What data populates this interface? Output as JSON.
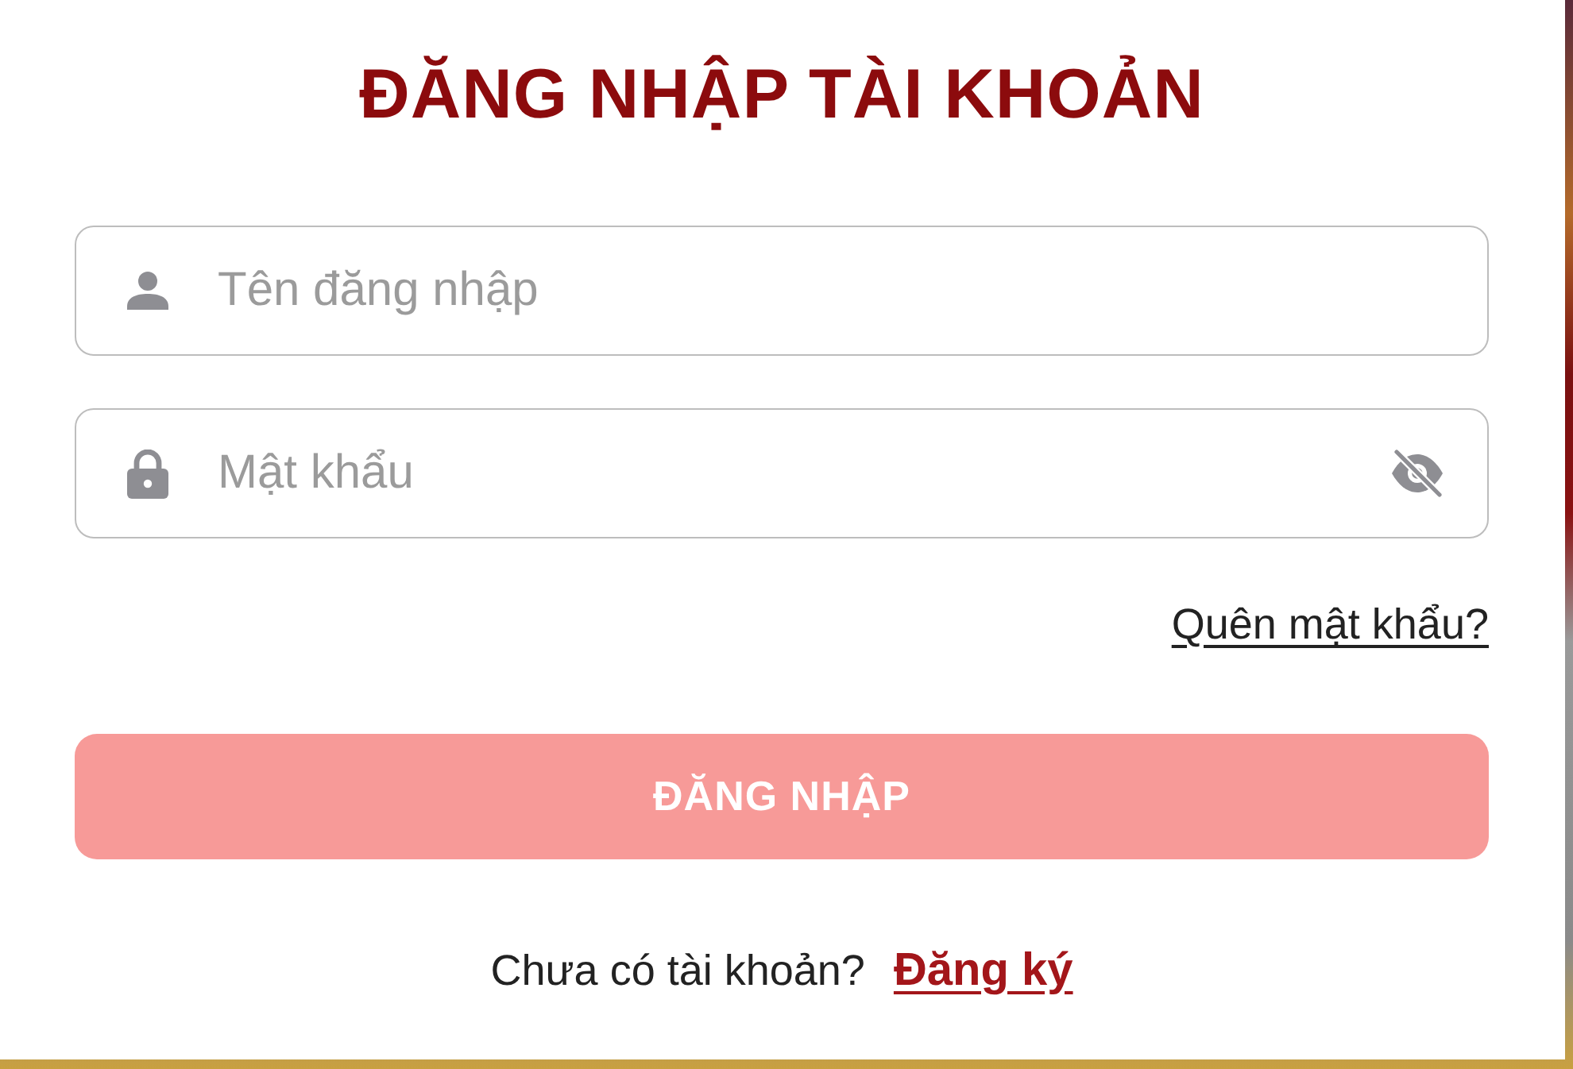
{
  "title": "ĐĂNG NHẬP TÀI KHOẢN",
  "fields": [
    {
      "kind": "text",
      "placeholder": "Tên đăng nhập"
    },
    {
      "kind": "password",
      "placeholder": "Mật khẩu"
    }
  ],
  "forgot_link": "Quên mật khẩu?",
  "submit_button": {
    "label": "ĐĂNG NHẬP",
    "disabled": true
  },
  "signup": {
    "prompt": "Chưa có tài khoản?",
    "link": "Đăng ký"
  }
}
